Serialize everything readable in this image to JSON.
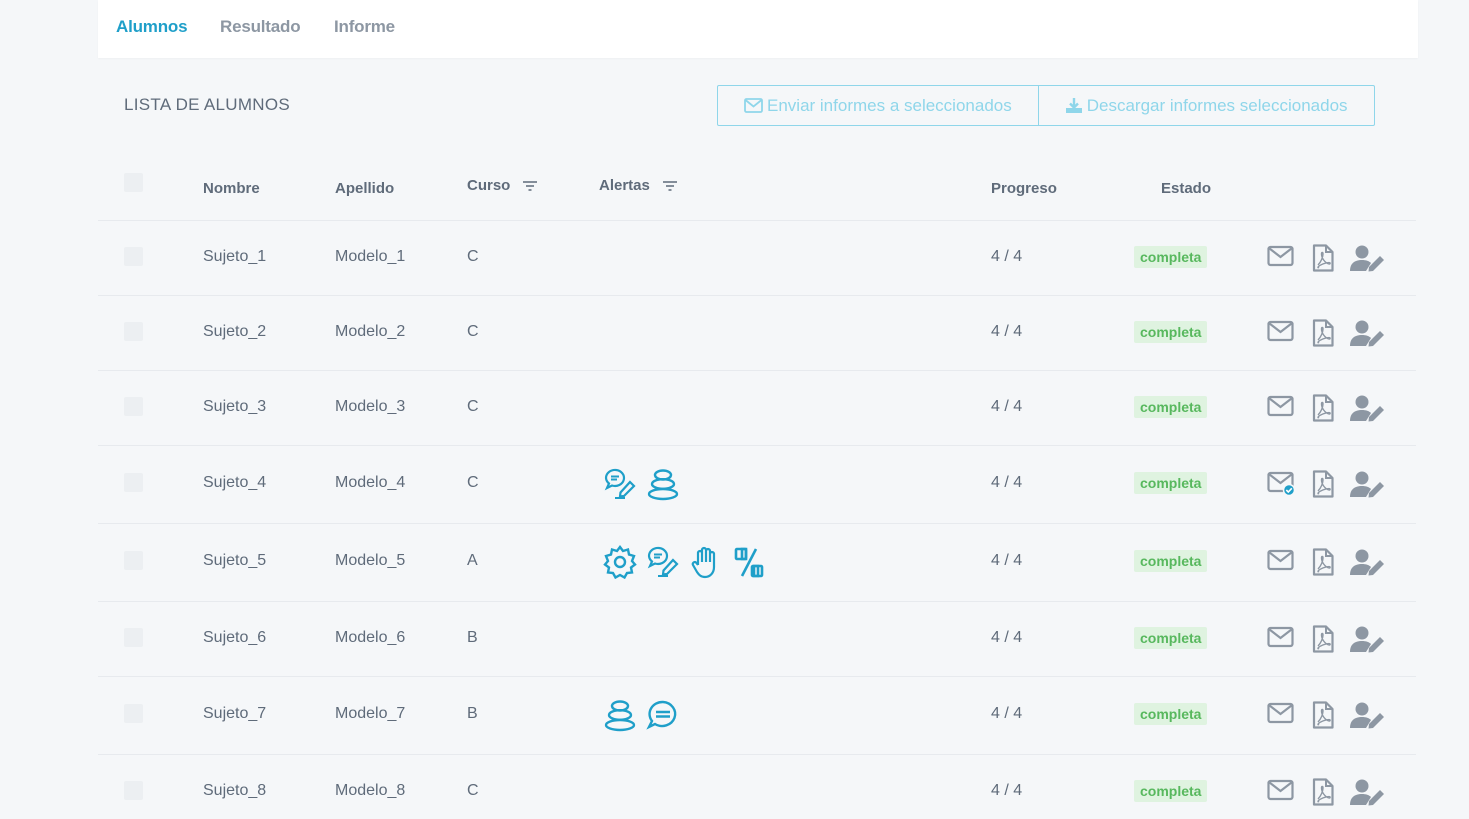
{
  "tabs": [
    {
      "label": "Alumnos",
      "active": true
    },
    {
      "label": "Resultado",
      "active": false
    },
    {
      "label": "Informe",
      "active": false
    }
  ],
  "section_title": "LISTA DE ALUMNOS",
  "buttons": {
    "send": "Enviar informes a seleccionados",
    "download": "Descargar informes seleccionados"
  },
  "columns": {
    "nombre": "Nombre",
    "apellido": "Apellido",
    "curso": "Curso",
    "alertas": "Alertas",
    "progreso": "Progreso",
    "estado": "Estado"
  },
  "rows": [
    {
      "nombre": "Sujeto_1",
      "apellido": "Modelo_1",
      "curso": "C",
      "progreso": "4 / 4",
      "estado": "completa",
      "alerts": [],
      "mail_sent": false
    },
    {
      "nombre": "Sujeto_2",
      "apellido": "Modelo_2",
      "curso": "C",
      "progreso": "4 / 4",
      "estado": "completa",
      "alerts": [],
      "mail_sent": false
    },
    {
      "nombre": "Sujeto_3",
      "apellido": "Modelo_3",
      "curso": "C",
      "progreso": "4 / 4",
      "estado": "completa",
      "alerts": [],
      "mail_sent": false
    },
    {
      "nombre": "Sujeto_4",
      "apellido": "Modelo_4",
      "curso": "C",
      "progreso": "4 / 4",
      "estado": "completa",
      "alerts": [
        "speech-pencil-icon",
        "stacked-stones-icon"
      ],
      "mail_sent": true
    },
    {
      "nombre": "Sujeto_5",
      "apellido": "Modelo_5",
      "curso": "A",
      "progreso": "4 / 4",
      "estado": "completa",
      "alerts": [
        "gear-icon",
        "speech-pencil-icon",
        "raised-hand-icon",
        "percent-icon"
      ],
      "mail_sent": false
    },
    {
      "nombre": "Sujeto_6",
      "apellido": "Modelo_6",
      "curso": "B",
      "progreso": "4 / 4",
      "estado": "completa",
      "alerts": [],
      "mail_sent": false
    },
    {
      "nombre": "Sujeto_7",
      "apellido": "Modelo_7",
      "curso": "B",
      "progreso": "4 / 4",
      "estado": "completa",
      "alerts": [
        "stacked-stones-icon",
        "speech-bubble-icon"
      ],
      "mail_sent": false
    },
    {
      "nombre": "Sujeto_8",
      "apellido": "Modelo_8",
      "curso": "C",
      "progreso": "4 / 4",
      "estado": "completa",
      "alerts": [],
      "mail_sent": false
    }
  ],
  "colors": {
    "accent": "#1f9fc9",
    "button_outline": "#8fd6ea",
    "badge_bg": "#dff3e0",
    "badge_text": "#58b85e",
    "action_icon": "#8d97a3"
  }
}
